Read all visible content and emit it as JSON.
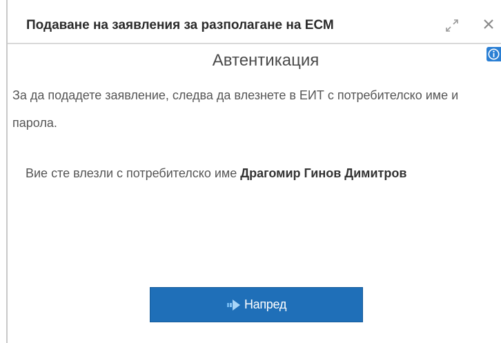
{
  "dialog": {
    "title": "Подаване на заявления за разполагане на ЕСМ",
    "icons": {
      "maximize": "maximize-icon",
      "close": "close-icon",
      "info": "info-icon"
    }
  },
  "content": {
    "heading": "Автентикация",
    "instruction": "За да подадете заявление, следва да влезнете в ЕИТ с потребителско име и парола.",
    "login_prefix": "Вие сте влезли с потребителско име ",
    "user_name": "Драгомир Гинов Димитров"
  },
  "actions": {
    "next_label": "Напред",
    "next_icon": "arrow-right-icon"
  },
  "colors": {
    "button": "#1f6fb8",
    "info_icon": "#2a7fd4",
    "text": "#555555"
  }
}
